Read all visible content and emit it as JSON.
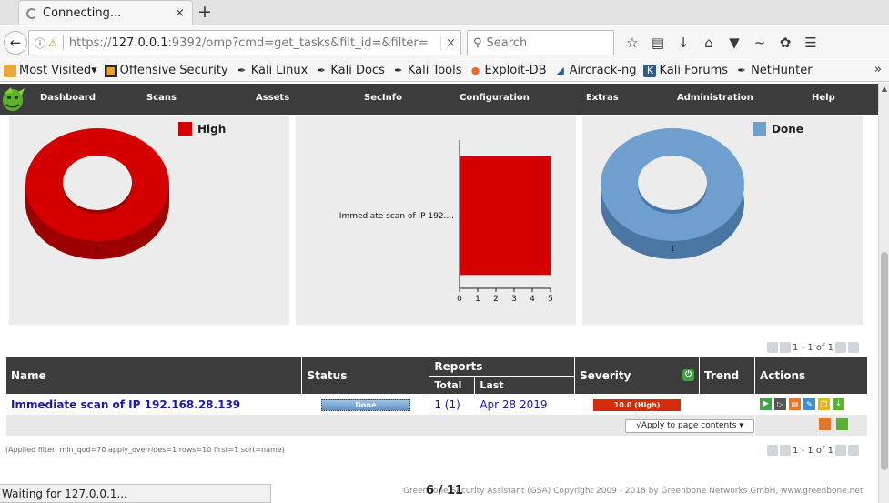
{
  "browser": {
    "tab_title": "Connecting...",
    "tab_close": "×",
    "new_tab": "+",
    "url_prefix": "https://",
    "url_host": "127.0.0.1",
    "url_rest": ":9392/omp?cmd=get_tasks&filt_id=&filter=",
    "url_clear": "×",
    "search_placeholder": "Search",
    "bookmarks": [
      {
        "label": "Most Visited",
        "icon": "folder-icon",
        "dropdown": "▾"
      },
      {
        "label": "Offensive Security",
        "icon": "offsec-icon"
      },
      {
        "label": "Kali Linux",
        "icon": "kali-dragon-icon"
      },
      {
        "label": "Kali Docs",
        "icon": "kali-dragon-icon"
      },
      {
        "label": "Kali Tools",
        "icon": "kali-dragon-icon"
      },
      {
        "label": "Exploit-DB",
        "icon": "exploit-db-icon"
      },
      {
        "label": "Aircrack-ng",
        "icon": "aircrack-icon"
      },
      {
        "label": "Kali Forums",
        "icon": "kali-forums-icon"
      },
      {
        "label": "NetHunter",
        "icon": "kali-dragon-icon"
      }
    ],
    "bookmarks_more": "»",
    "status_text": "Waiting for 127.0.0.1..."
  },
  "menu": {
    "items": [
      "Dashboard",
      "Scans",
      "Assets",
      "SecInfo",
      "Configuration",
      "Extras",
      "Administration",
      "Help"
    ]
  },
  "colors": {
    "high": "#d40000",
    "done": "#6f9fcf",
    "menu_bg": "#3c3c3c",
    "link": "#1a1aa6"
  },
  "charts": {
    "severity_donut": {
      "legend": "High",
      "label": "1"
    },
    "status_donut": {
      "legend": "Done",
      "label": "1"
    }
  },
  "chart_data": [
    {
      "type": "pie",
      "categories": [
        "High"
      ],
      "values": [
        1
      ],
      "legend": "top-right"
    },
    {
      "type": "bar",
      "orientation": "horizontal",
      "categories": [
        "Immediate scan of IP 192...."
      ],
      "values": [
        5
      ],
      "xlim": [
        0,
        5
      ],
      "xticks": [
        "0",
        "1",
        "2",
        "3",
        "4",
        "5"
      ]
    },
    {
      "type": "pie",
      "categories": [
        "Done"
      ],
      "values": [
        1
      ],
      "legend": "top-right"
    }
  ],
  "pagination": {
    "top_label": "1 - 1 of 1",
    "bottom_label": "1 - 1 of 1"
  },
  "table": {
    "headers": {
      "name": "Name",
      "status": "Status",
      "reports": "Reports",
      "total": "Total",
      "last": "Last",
      "severity": "Severity",
      "trend": "Trend",
      "actions": "Actions"
    },
    "row": {
      "name": "Immediate scan of IP 192.168.28.139",
      "status": "Done",
      "total": "1 (1)",
      "last": "Apr 28 2019",
      "severity": "10.0 (High)",
      "severity_level": 1.0,
      "trend": ""
    },
    "apply_option": "√Apply to page contents"
  },
  "applied_filter": "(Applied filter: min_qod=70 apply_overrides=1 rows=10 first=1 sort=name)",
  "footer": "Greenbone Security Assistant (GSA) Copyright 2009 - 2018 by Greenbone Networks GmbH, www.greenbone.net",
  "page_count": "6 / 11"
}
